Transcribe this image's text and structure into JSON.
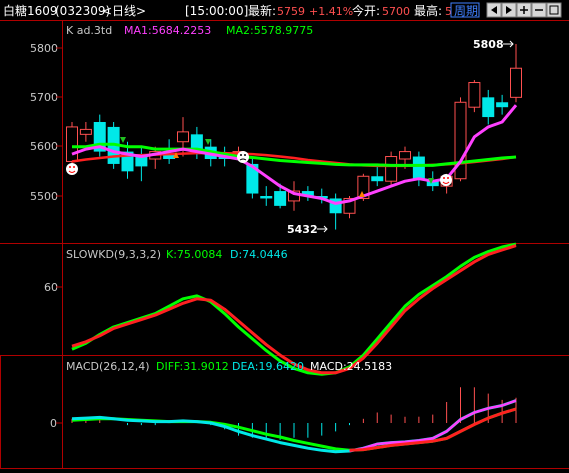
{
  "header": {
    "title": "白糖1609",
    "code": "(032309)",
    "period_tag": "<日线>",
    "time": "[15:00:00]",
    "latest_label": "最新:",
    "latest_value": "5759",
    "change_pct": "+1.41%",
    "open_label": "今开:",
    "open_value": "5700",
    "high_label": "最高:",
    "high_value": "5",
    "period_button": "周期",
    "icons": [
      "prev-icon",
      "next-icon",
      "zoom-in-icon",
      "zoom-out-icon",
      "fullscreen-icon"
    ]
  },
  "colors": {
    "up": "#ff5050",
    "down": "#00e8e8",
    "ma1": "#ff40ff",
    "ma2": "#00ff00",
    "ma3": "#ff2020",
    "frame": "#b00000",
    "axis_text": "#c8c8c8"
  },
  "main_panel": {
    "legend_prefix": "K  ad.3td",
    "ma1_label": "MA1:5684.2253",
    "ma2_label": "MA2:5578.9775",
    "y_ticks": [
      "5800",
      "5700",
      "5600",
      "5500"
    ],
    "high_marker": "5808",
    "low_marker": "5432"
  },
  "kd_panel": {
    "title": "SLOWKD(9,3,3,2)",
    "k_label": "K:75.0084",
    "d_label": "D:74.0446",
    "y_ticks": [
      "60"
    ]
  },
  "macd_panel": {
    "title": "MACD(26,12,4)",
    "diff_label": "DIFF:31.9012",
    "dea_label": "DEA:19.6420",
    "macd_label": "MACD:24.5183",
    "y_ticks": [
      "0"
    ]
  },
  "chart_data": {
    "type": "candlestick",
    "title": "白糖1609",
    "ylim_price": [
      5410,
      5830
    ],
    "candles": [
      {
        "o": 5570,
        "h": 5650,
        "l": 5555,
        "c": 5640
      },
      {
        "o": 5625,
        "h": 5650,
        "l": 5610,
        "c": 5635
      },
      {
        "o": 5650,
        "h": 5665,
        "l": 5580,
        "c": 5590
      },
      {
        "o": 5640,
        "h": 5650,
        "l": 5555,
        "c": 5565
      },
      {
        "o": 5590,
        "h": 5610,
        "l": 5535,
        "c": 5550
      },
      {
        "o": 5580,
        "h": 5600,
        "l": 5530,
        "c": 5560
      },
      {
        "o": 5575,
        "h": 5600,
        "l": 5555,
        "c": 5590
      },
      {
        "o": 5585,
        "h": 5615,
        "l": 5565,
        "c": 5575
      },
      {
        "o": 5610,
        "h": 5660,
        "l": 5580,
        "c": 5630
      },
      {
        "o": 5625,
        "h": 5640,
        "l": 5575,
        "c": 5590
      },
      {
        "o": 5600,
        "h": 5615,
        "l": 5560,
        "c": 5575
      },
      {
        "o": 5585,
        "h": 5600,
        "l": 5560,
        "c": 5575
      },
      {
        "o": 5590,
        "h": 5600,
        "l": 5575,
        "c": 5590
      },
      {
        "o": 5565,
        "h": 5575,
        "l": 5495,
        "c": 5505
      },
      {
        "o": 5500,
        "h": 5520,
        "l": 5480,
        "c": 5495
      },
      {
        "o": 5510,
        "h": 5525,
        "l": 5475,
        "c": 5480
      },
      {
        "o": 5490,
        "h": 5530,
        "l": 5470,
        "c": 5510
      },
      {
        "o": 5510,
        "h": 5520,
        "l": 5490,
        "c": 5500
      },
      {
        "o": 5500,
        "h": 5515,
        "l": 5485,
        "c": 5495
      },
      {
        "o": 5495,
        "h": 5505,
        "l": 5432,
        "c": 5465
      },
      {
        "o": 5465,
        "h": 5500,
        "l": 5455,
        "c": 5495
      },
      {
        "o": 5495,
        "h": 5545,
        "l": 5490,
        "c": 5540
      },
      {
        "o": 5540,
        "h": 5560,
        "l": 5520,
        "c": 5530
      },
      {
        "o": 5530,
        "h": 5590,
        "l": 5520,
        "c": 5580
      },
      {
        "o": 5575,
        "h": 5600,
        "l": 5555,
        "c": 5590
      },
      {
        "o": 5580,
        "h": 5590,
        "l": 5520,
        "c": 5535
      },
      {
        "o": 5530,
        "h": 5550,
        "l": 5510,
        "c": 5520
      },
      {
        "o": 5520,
        "h": 5545,
        "l": 5505,
        "c": 5540
      },
      {
        "o": 5535,
        "h": 5700,
        "l": 5530,
        "c": 5690
      },
      {
        "o": 5680,
        "h": 5735,
        "l": 5670,
        "c": 5730
      },
      {
        "o": 5700,
        "h": 5715,
        "l": 5645,
        "c": 5660
      },
      {
        "o": 5690,
        "h": 5705,
        "l": 5665,
        "c": 5680
      },
      {
        "o": 5700,
        "h": 5808,
        "l": 5690,
        "c": 5759
      }
    ],
    "ma1": [
      5585,
      5595,
      5600,
      5590,
      5585,
      5580,
      5585,
      5590,
      5595,
      5590,
      5585,
      5580,
      5575,
      5560,
      5540,
      5520,
      5505,
      5500,
      5495,
      5485,
      5490,
      5500,
      5510,
      5520,
      5530,
      5535,
      5530,
      5535,
      5570,
      5620,
      5640,
      5650,
      5684
    ],
    "ma2": [
      5600,
      5600,
      5605,
      5605,
      5600,
      5600,
      5595,
      5595,
      5595,
      5595,
      5590,
      5585,
      5580,
      5578,
      5575,
      5572,
      5570,
      5568,
      5566,
      5564,
      5563,
      5563,
      5563,
      5562,
      5562,
      5562,
      5562,
      5565,
      5568,
      5571,
      5574,
      5577,
      5579
    ],
    "ma3": [
      5570,
      5574,
      5577,
      5580,
      5582,
      5583,
      5584,
      5585,
      5586,
      5587,
      5587,
      5587,
      5586,
      5585,
      5583,
      5580,
      5577,
      5573,
      5570,
      5567,
      5564,
      5562,
      5561,
      5561,
      5561,
      5562,
      5563,
      5564,
      5566,
      5569,
      5572,
      5575,
      5579
    ],
    "kd": {
      "ylim": [
        0,
        100
      ],
      "k": [
        18,
        22,
        28,
        33,
        36,
        39,
        42,
        47,
        52,
        54,
        50,
        42,
        33,
        25,
        17,
        10,
        5,
        2,
        1,
        2,
        6,
        14,
        25,
        36,
        47,
        55,
        61,
        67,
        74,
        80,
        84,
        87,
        89
      ],
      "d": [
        20,
        23,
        27,
        32,
        35,
        38,
        41,
        45,
        49,
        52,
        51,
        45,
        37,
        29,
        21,
        14,
        8,
        4,
        2,
        2,
        5,
        12,
        22,
        33,
        44,
        52,
        59,
        65,
        71,
        77,
        82,
        85,
        88
      ]
    },
    "macd": {
      "ylim": [
        -60,
        50
      ],
      "diff": [
        6,
        7,
        8,
        6,
        4,
        3,
        2,
        2,
        3,
        2,
        0,
        -5,
        -12,
        -18,
        -23,
        -28,
        -32,
        -36,
        -39,
        -41,
        -40,
        -36,
        -30,
        -28,
        -27,
        -25,
        -22,
        -12,
        5,
        15,
        21,
        25,
        32
      ],
      "dea": [
        4,
        5,
        6,
        6,
        5,
        4,
        3,
        2,
        2,
        2,
        1,
        -2,
        -6,
        -11,
        -16,
        -20,
        -25,
        -29,
        -33,
        -37,
        -39,
        -38,
        -35,
        -32,
        -30,
        -28,
        -26,
        -22,
        -12,
        -2,
        7,
        14,
        20
      ],
      "bars": [
        2,
        2,
        2,
        0,
        -1,
        -1,
        -1,
        0,
        1,
        0,
        -1,
        -3,
        -6,
        -7,
        -7,
        -8,
        -7,
        -7,
        -6,
        -4,
        -1,
        2,
        5,
        4,
        3,
        3,
        4,
        10,
        17,
        17,
        14,
        11,
        12
      ]
    }
  }
}
